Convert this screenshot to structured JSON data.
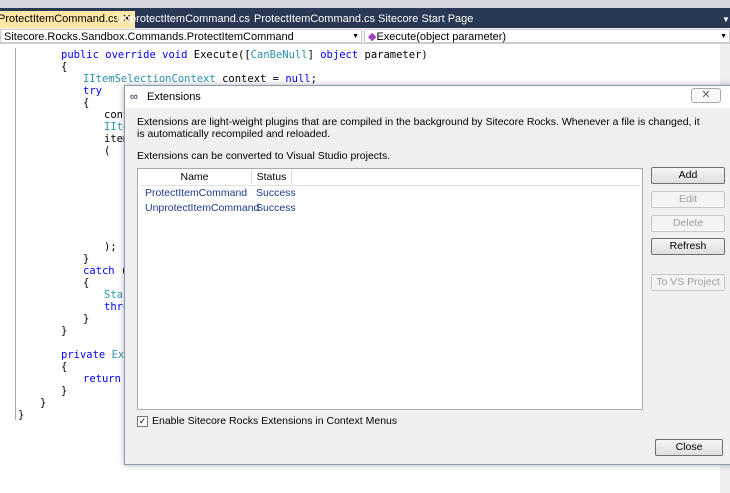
{
  "tabs": [
    {
      "label": "ProtectItemCommand.cs",
      "active": true
    },
    {
      "label": "UnprotectItemCommand.cs"
    },
    {
      "label": "ProtectItemCommand.cs"
    },
    {
      "label": "Sitecore Start Page"
    }
  ],
  "nav": {
    "type_combo": "Sitecore.Rocks.Sandbox.Commands.ProtectItemCommand",
    "member_combo": "Execute(object parameter)"
  },
  "code": [
    {
      "indent": 61,
      "parts": [
        [
          "kw",
          "public override void "
        ],
        [
          "",
          "Execute(["
        ],
        [
          "ty",
          "CanBeNull"
        ],
        [
          "",
          "] "
        ],
        [
          "kw",
          "object"
        ],
        [
          "",
          " parameter)"
        ]
      ]
    },
    {
      "indent": 61,
      "parts": [
        [
          "",
          "{"
        ]
      ]
    },
    {
      "indent": 83,
      "parts": [
        [
          "ty",
          "IItemSelectionContext"
        ],
        [
          "",
          " context = "
        ],
        [
          "kw",
          "null"
        ],
        [
          "",
          ";"
        ]
      ]
    },
    {
      "indent": 83,
      "parts": [
        [
          "kw",
          "try"
        ]
      ]
    },
    {
      "indent": 83,
      "parts": [
        [
          "",
          "{"
        ]
      ]
    },
    {
      "indent": 104,
      "parts": [
        [
          "",
          "cont"
        ]
      ]
    },
    {
      "indent": 104,
      "parts": [
        [
          "ty",
          "IIte"
        ]
      ]
    },
    {
      "indent": 104,
      "parts": [
        [
          "",
          "item"
        ]
      ]
    },
    {
      "indent": 104,
      "parts": [
        [
          "",
          "("
        ]
      ]
    },
    {
      "indent": 104,
      "parts": []
    },
    {
      "indent": 104,
      "parts": []
    },
    {
      "indent": 104,
      "parts": []
    },
    {
      "indent": 104,
      "parts": []
    },
    {
      "indent": 104,
      "parts": []
    },
    {
      "indent": 104,
      "parts": []
    },
    {
      "indent": 104,
      "parts": []
    },
    {
      "indent": 104,
      "parts": [
        [
          "",
          ");"
        ]
      ]
    },
    {
      "indent": 83,
      "parts": [
        [
          "",
          "}"
        ]
      ]
    },
    {
      "indent": 83,
      "parts": [
        [
          "kw",
          "catch"
        ],
        [
          "",
          " (E"
        ]
      ]
    },
    {
      "indent": 83,
      "parts": [
        [
          "",
          "{"
        ]
      ]
    },
    {
      "indent": 104,
      "parts": [
        [
          "ty",
          "Stac"
        ]
      ]
    },
    {
      "indent": 104,
      "parts": [
        [
          "kw",
          "thro"
        ]
      ]
    },
    {
      "indent": 83,
      "parts": [
        [
          "",
          "}"
        ]
      ]
    },
    {
      "indent": 61,
      "parts": [
        [
          "",
          "}"
        ]
      ]
    },
    {
      "indent": 61,
      "parts": []
    },
    {
      "indent": 61,
      "parts": [
        [
          "kw",
          "private "
        ],
        [
          "ty",
          "Exec"
        ]
      ]
    },
    {
      "indent": 61,
      "parts": [
        [
          "",
          "{"
        ]
      ]
    },
    {
      "indent": 83,
      "parts": [
        [
          "kw",
          "return"
        ],
        [
          "",
          " ("
        ]
      ]
    },
    {
      "indent": 61,
      "parts": [
        [
          "",
          "}"
        ]
      ]
    },
    {
      "indent": 40,
      "parts": [
        [
          "",
          "}"
        ]
      ]
    },
    {
      "indent": 18,
      "parts": [
        [
          "",
          "}"
        ]
      ]
    }
  ],
  "dialog": {
    "title": "Extensions",
    "desc1": "Extensions are light-weight plugins that are compiled in the background by Sitecore Rocks. Whenever a file is changed, it is automatically recompiled and reloaded.",
    "desc2": "Extensions can be converted to Visual Studio projects.",
    "columns": [
      "Name",
      "Status"
    ],
    "rows": [
      [
        "ProtectItemCommand",
        "Success"
      ],
      [
        "UnprotectItemCommand",
        "Success"
      ]
    ],
    "buttons": {
      "add": "Add",
      "edit": "Edit",
      "delete": "Delete",
      "refresh": "Refresh",
      "to_vs": "To VS Project",
      "close": "Close"
    },
    "checkbox": {
      "label": "Enable Sitecore Rocks Extensions in Context Menus",
      "checked": true
    }
  }
}
